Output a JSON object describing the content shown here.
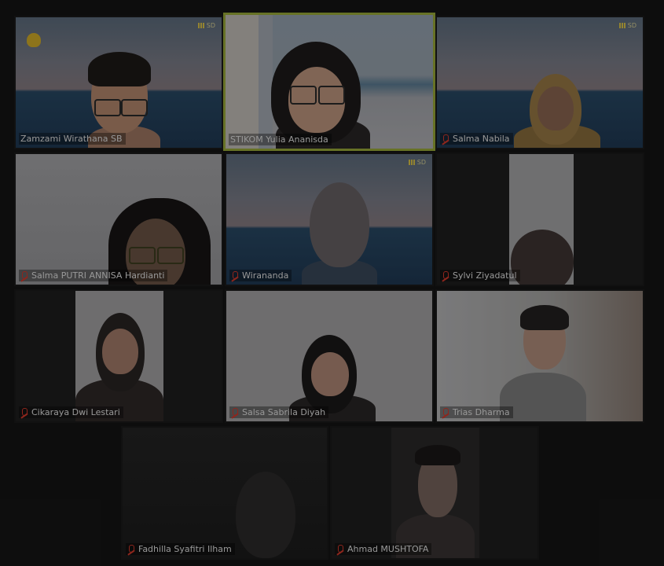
{
  "participants": [
    {
      "name": "Zamzami Wirathana SB",
      "muted": false
    },
    {
      "name": "STIKOM Yulia Ananisda",
      "muted": false
    },
    {
      "name": "Salma Nabila",
      "muted": true
    },
    {
      "name": "Salma PUTRI ANNISA Hardianti",
      "muted": true
    },
    {
      "name": "Wirananda",
      "muted": true
    },
    {
      "name": "Sylvi Ziyadatul",
      "muted": true
    },
    {
      "name": "Cikaraya Dwi Lestari",
      "muted": true
    },
    {
      "name": "Salsa Sabrila Diyah",
      "muted": true
    },
    {
      "name": "Trias Dharma",
      "muted": true
    },
    {
      "name": "Fadhilla Syafitri Ilham",
      "muted": true
    },
    {
      "name": "Ahmad MUSHTOFA",
      "muted": true
    }
  ],
  "signal": {
    "label": "SD"
  },
  "colors": {
    "active_border": "#9dad3a",
    "muted_icon": "#d83a2c",
    "background": "#151515"
  }
}
